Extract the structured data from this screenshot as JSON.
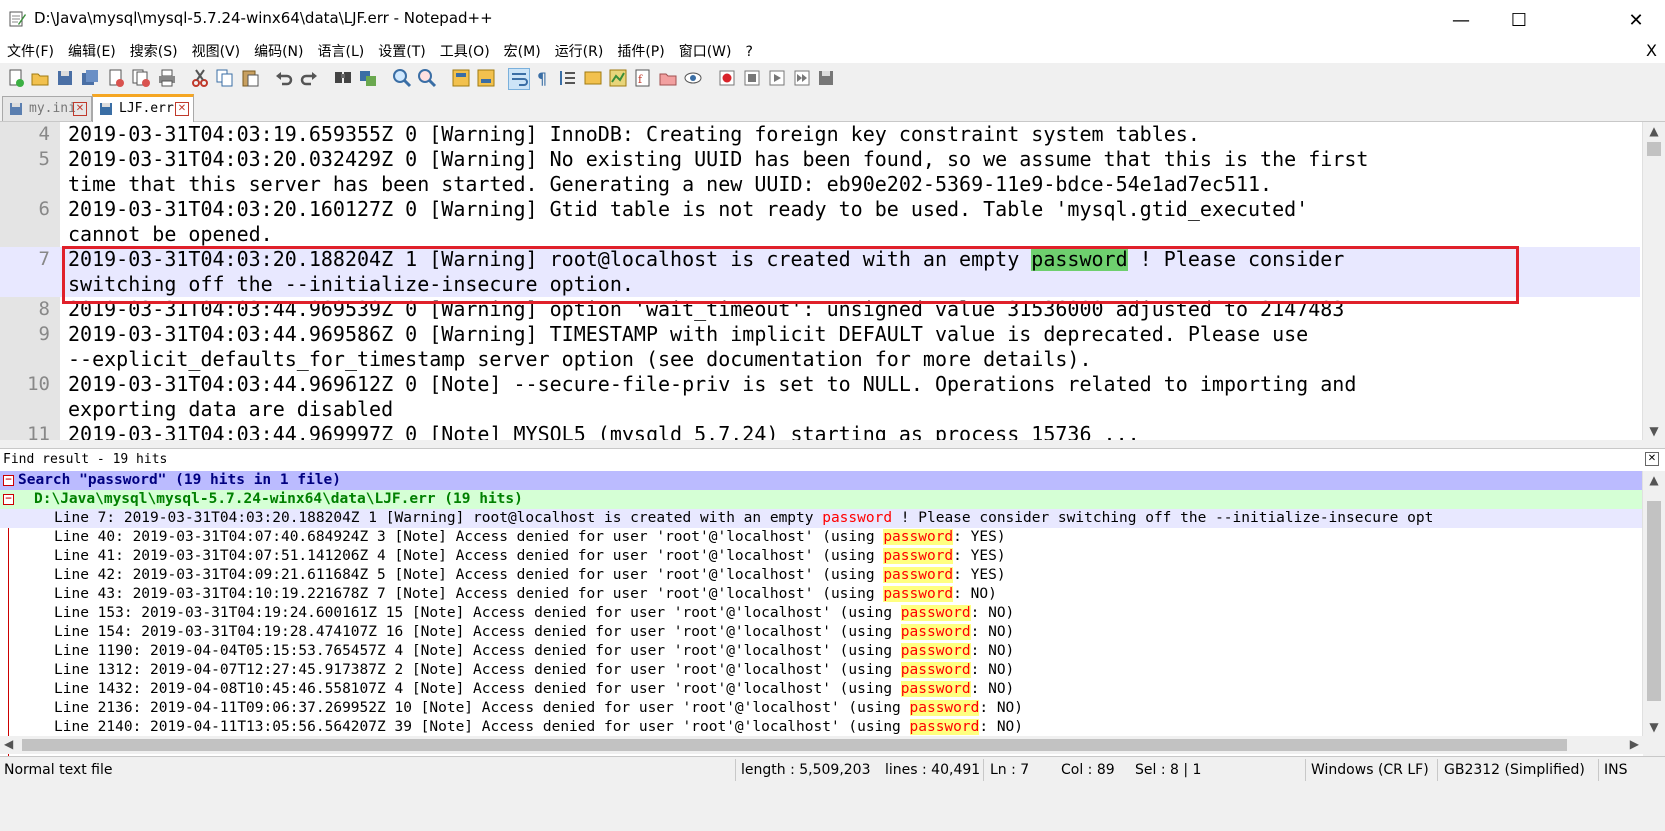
{
  "window": {
    "title": "D:\\Java\\mysql\\mysql-5.7.24-winx64\\data\\LJF.err - Notepad++",
    "minimize": "—",
    "maximize": "☐",
    "close": "✕"
  },
  "menu": [
    "文件(F)",
    "编辑(E)",
    "搜索(S)",
    "视图(V)",
    "编码(N)",
    "语言(L)",
    "设置(T)",
    "工具(O)",
    "宏(M)",
    "运行(R)",
    "插件(P)",
    "窗口(W)",
    "?"
  ],
  "menu_close": "X",
  "tabs": [
    {
      "label": "my.ini",
      "active": false
    },
    {
      "label": "LJF.err",
      "active": true
    }
  ],
  "editor": {
    "lines": [
      {
        "num": "4",
        "text": "2019-03-31T04:03:19.659355Z 0 [Warning] InnoDB: Creating foreign key constraint system tables."
      },
      {
        "num": "5",
        "text": "2019-03-31T04:03:20.032429Z 0 [Warning] No existing UUID has been found, so we assume that this is the first"
      },
      {
        "num": "",
        "text": "time that this server has been started. Generating a new UUID: eb90e202-5369-11e9-bdce-54e1ad7ec511."
      },
      {
        "num": "6",
        "text": "2019-03-31T04:03:20.160127Z 0 [Warning] Gtid table is not ready to be used. Table 'mysql.gtid_executed'"
      },
      {
        "num": "",
        "text": "cannot be opened."
      },
      {
        "num": "7",
        "pre": "2019-03-31T04:03:20.188204Z 1 [Warning] root@localhost is created with an empty ",
        "match": "password",
        "post": " ! Please consider"
      },
      {
        "num": "",
        "text": "switching off the --initialize-insecure option."
      },
      {
        "num": "8",
        "text": "2019-03-31T04:03:44.969539Z 0 [Warning] option 'wait_timeout': unsigned value 31536000 adjusted to 2147483"
      },
      {
        "num": "9",
        "text": "2019-03-31T04:03:44.969586Z 0 [Warning] TIMESTAMP with implicit DEFAULT value is deprecated. Please use"
      },
      {
        "num": "",
        "text": "--explicit_defaults_for_timestamp server option (see documentation for more details)."
      },
      {
        "num": "10",
        "text": "2019-03-31T04:03:44.969612Z 0 [Note] --secure-file-priv is set to NULL. Operations related to importing and"
      },
      {
        "num": "",
        "text": "exporting data are disabled"
      },
      {
        "num": "11",
        "text": "2019-03-31T04:03:44.969997Z 0 [Note] MYSQL5 (mysqld 5.7.24) starting as process 15736 ..."
      }
    ]
  },
  "find": {
    "header": "Find result - 19 hits",
    "search_line": "Search \"password\" (19 hits in 1 file)",
    "file_line": "D:\\Java\\mysql\\mysql-5.7.24-winx64\\data\\LJF.err (19 hits)",
    "keyword": "password",
    "results": [
      {
        "pre": "Line 7: 2019-03-31T04:03:20.188204Z 1 [Warning] root@localhost is created with an empty ",
        "post": " ! Please consider switching off the --initialize-insecure opt"
      },
      {
        "pre": "Line 40: 2019-03-31T04:07:40.684924Z 3 [Note] Access denied for user 'root'@'localhost' (using ",
        "post": ": YES)"
      },
      {
        "pre": "Line 41: 2019-03-31T04:07:51.141206Z 4 [Note] Access denied for user 'root'@'localhost' (using ",
        "post": ": YES)"
      },
      {
        "pre": "Line 42: 2019-03-31T04:09:21.611684Z 5 [Note] Access denied for user 'root'@'localhost' (using ",
        "post": ": YES)"
      },
      {
        "pre": "Line 43: 2019-03-31T04:10:19.221678Z 7 [Note] Access denied for user 'root'@'localhost' (using ",
        "post": ": NO)"
      },
      {
        "pre": "Line 153: 2019-03-31T04:19:24.600161Z 15 [Note] Access denied for user 'root'@'localhost' (using ",
        "post": ": NO)"
      },
      {
        "pre": "Line 154: 2019-03-31T04:19:28.474107Z 16 [Note] Access denied for user 'root'@'localhost' (using ",
        "post": ": NO)"
      },
      {
        "pre": "Line 1190: 2019-04-04T05:15:53.765457Z 4 [Note] Access denied for user 'root'@'localhost' (using ",
        "post": ": NO)"
      },
      {
        "pre": "Line 1312: 2019-04-07T12:27:45.917387Z 2 [Note] Access denied for user 'root'@'localhost' (using ",
        "post": ": NO)"
      },
      {
        "pre": "Line 1432: 2019-04-08T10:45:46.558107Z 4 [Note] Access denied for user 'root'@'localhost' (using ",
        "post": ": NO)"
      },
      {
        "pre": "Line 2136: 2019-04-11T09:06:37.269952Z 10 [Note] Access denied for user 'root'@'localhost' (using ",
        "post": ": NO)"
      },
      {
        "pre": "Line 2140: 2019-04-11T13:05:56.564207Z 39 [Note] Access denied for user 'root'@'localhost' (using ",
        "post": ": NO)"
      }
    ]
  },
  "status": {
    "type": "Normal text file",
    "length": "length : 5,509,203",
    "lines": "lines : 40,491",
    "ln": "Ln : 7",
    "col": "Col : 89",
    "sel": "Sel : 8 | 1",
    "eol": "Windows (CR LF)",
    "encoding": "GB2312 (Simplified)",
    "mode": "INS"
  }
}
